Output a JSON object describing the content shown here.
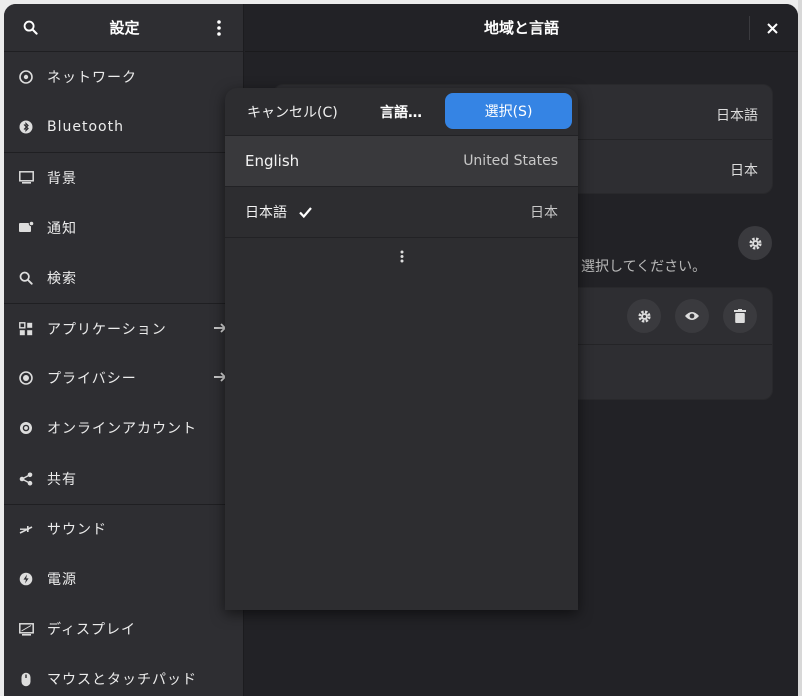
{
  "sidebar": {
    "title": "設定",
    "items": [
      {
        "label": "ネットワーク",
        "icon": "network-icon"
      },
      {
        "label": "Bluetooth",
        "icon": "bluetooth-icon"
      },
      {
        "label": "背景",
        "icon": "background-icon"
      },
      {
        "label": "通知",
        "icon": "notifications-icon"
      },
      {
        "label": "検索",
        "icon": "search-icon"
      },
      {
        "label": "アプリケーション",
        "icon": "apps-icon",
        "arrow": true
      },
      {
        "label": "プライバシー",
        "icon": "privacy-icon",
        "arrow": true
      },
      {
        "label": "オンラインアカウント",
        "icon": "online-accounts-icon"
      },
      {
        "label": "共有",
        "icon": "sharing-icon"
      },
      {
        "label": "サウンド",
        "icon": "sound-icon"
      },
      {
        "label": "電源",
        "icon": "power-icon"
      },
      {
        "label": "ディスプレイ",
        "icon": "display-icon"
      },
      {
        "label": "マウスとタッチパッド",
        "icon": "mouse-icon"
      }
    ]
  },
  "main": {
    "title": "地域と言語",
    "language_value": "日本語",
    "formats_value": "日本",
    "hint_text": "選択してください。"
  },
  "popover": {
    "cancel_label": "キャンセル(C)",
    "title": "言語…",
    "select_label": "選択(S)",
    "languages": [
      {
        "name": "English",
        "region": "United States",
        "selected": true
      },
      {
        "name": "日本語",
        "region": "日本",
        "checked": true
      }
    ]
  },
  "colors": {
    "accent": "#3584e4",
    "window_bg": "#222226",
    "sidebar_bg": "#2e2e32"
  }
}
